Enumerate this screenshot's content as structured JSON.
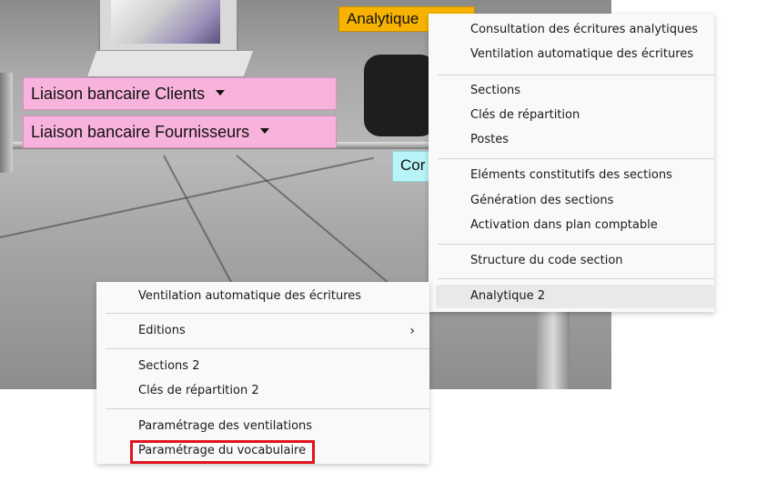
{
  "background": {
    "chips": {
      "analytique": "Analytique",
      "liaison_clients": "Liaison bancaire Clients",
      "liaison_fournisseurs": "Liaison bancaire Fournisseurs",
      "partial_cyan": "Cor"
    }
  },
  "menu_right": {
    "items": [
      "Consultation des écritures analytiques",
      "Ventilation automatique des écritures",
      "Sections",
      "Clés de répartition",
      "Postes",
      "Eléments constitutifs des sections",
      "Génération des sections",
      "Activation dans plan comptable",
      "Structure du code section",
      "Analytique 2"
    ]
  },
  "menu_left": {
    "items": [
      "Ventilation automatique des écritures",
      "Editions",
      "Sections 2",
      "Clés de répartition 2",
      "Paramétrage des ventilations",
      "Paramétrage du vocabulaire"
    ],
    "submenu_arrow": "›"
  },
  "colors": {
    "pink_chip": "#f8b3dc",
    "orange_chip": "#f8b300",
    "cyan_chip": "#b7f3f7",
    "highlight_border": "#e0141e",
    "menu_bg": "#f9f9f9"
  }
}
